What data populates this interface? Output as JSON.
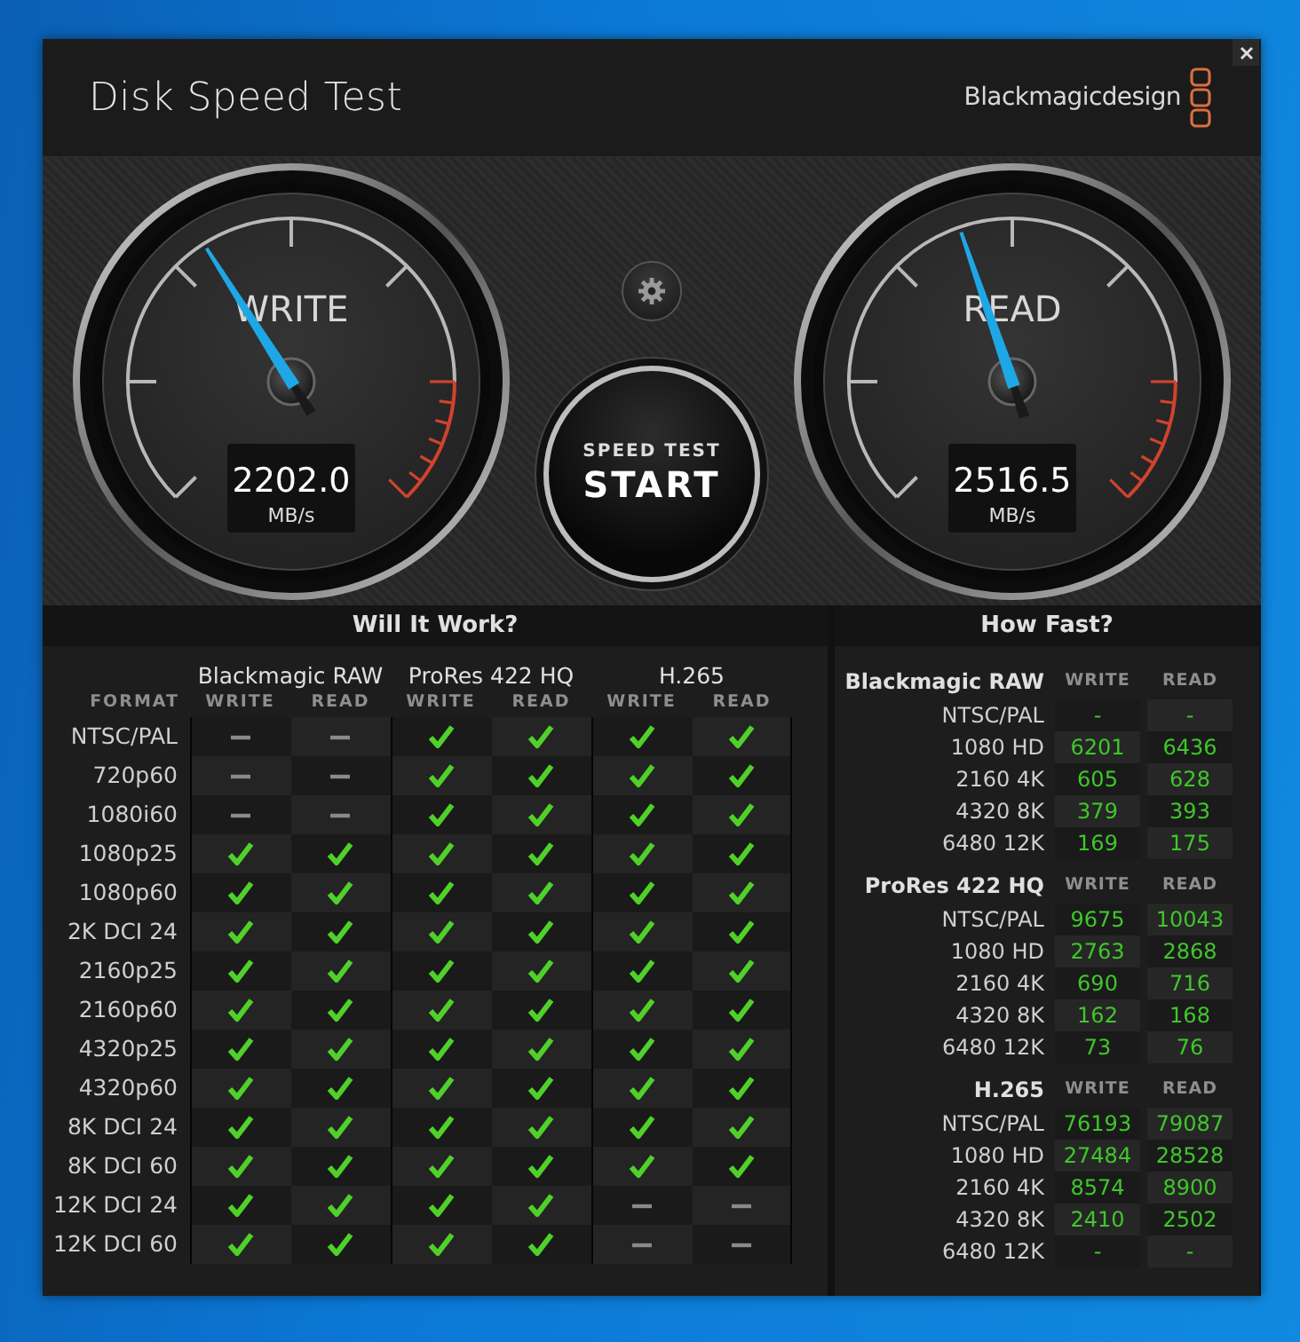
{
  "window": {
    "title": "Disk Speed Test",
    "brand": "Blackmagicdesign"
  },
  "gauges": [
    {
      "label": "WRITE",
      "value": "2202.0",
      "unit": "MB/s",
      "level": 0.38
    },
    {
      "label": "READ",
      "value": "2516.5",
      "unit": "MB/s",
      "level": 0.43
    }
  ],
  "start_button": {
    "caption": "SPEED TEST",
    "label": "START"
  },
  "will_it_work": {
    "title": "Will It Work?",
    "format_header": "FORMAT",
    "codecs": [
      {
        "name": "Blackmagic RAW",
        "columns": [
          "WRITE",
          "READ"
        ]
      },
      {
        "name": "ProRes 422 HQ",
        "columns": [
          "WRITE",
          "READ"
        ]
      },
      {
        "name": "H.265",
        "columns": [
          "WRITE",
          "READ"
        ]
      }
    ],
    "rows": [
      {
        "format": "NTSC/PAL",
        "supported": [
          false,
          false,
          true,
          true,
          true,
          true
        ]
      },
      {
        "format": "720p60",
        "supported": [
          false,
          false,
          true,
          true,
          true,
          true
        ]
      },
      {
        "format": "1080i60",
        "supported": [
          false,
          false,
          true,
          true,
          true,
          true
        ]
      },
      {
        "format": "1080p25",
        "supported": [
          true,
          true,
          true,
          true,
          true,
          true
        ]
      },
      {
        "format": "1080p60",
        "supported": [
          true,
          true,
          true,
          true,
          true,
          true
        ]
      },
      {
        "format": "2K DCI 24",
        "supported": [
          true,
          true,
          true,
          true,
          true,
          true
        ]
      },
      {
        "format": "2160p25",
        "supported": [
          true,
          true,
          true,
          true,
          true,
          true
        ]
      },
      {
        "format": "2160p60",
        "supported": [
          true,
          true,
          true,
          true,
          true,
          true
        ]
      },
      {
        "format": "4320p25",
        "supported": [
          true,
          true,
          true,
          true,
          true,
          true
        ]
      },
      {
        "format": "4320p60",
        "supported": [
          true,
          true,
          true,
          true,
          true,
          true
        ]
      },
      {
        "format": "8K DCI 24",
        "supported": [
          true,
          true,
          true,
          true,
          true,
          true
        ]
      },
      {
        "format": "8K DCI 60",
        "supported": [
          true,
          true,
          true,
          true,
          true,
          true
        ]
      },
      {
        "format": "12K DCI 24",
        "supported": [
          true,
          true,
          true,
          true,
          false,
          false
        ]
      },
      {
        "format": "12K DCI 60",
        "supported": [
          true,
          true,
          true,
          true,
          false,
          false
        ]
      }
    ]
  },
  "how_fast": {
    "title": "How Fast?",
    "groups": [
      {
        "codec": "Blackmagic RAW",
        "columns": [
          "WRITE",
          "READ"
        ],
        "rows": [
          {
            "resolution": "NTSC/PAL",
            "write": "-",
            "read": "-"
          },
          {
            "resolution": "1080 HD",
            "write": "6201",
            "read": "6436"
          },
          {
            "resolution": "2160 4K",
            "write": "605",
            "read": "628"
          },
          {
            "resolution": "4320 8K",
            "write": "379",
            "read": "393"
          },
          {
            "resolution": "6480 12K",
            "write": "169",
            "read": "175"
          }
        ]
      },
      {
        "codec": "ProRes 422 HQ",
        "columns": [
          "WRITE",
          "READ"
        ],
        "rows": [
          {
            "resolution": "NTSC/PAL",
            "write": "9675",
            "read": "10043"
          },
          {
            "resolution": "1080 HD",
            "write": "2763",
            "read": "2868"
          },
          {
            "resolution": "2160 4K",
            "write": "690",
            "read": "716"
          },
          {
            "resolution": "4320 8K",
            "write": "162",
            "read": "168"
          },
          {
            "resolution": "6480 12K",
            "write": "73",
            "read": "76"
          }
        ]
      },
      {
        "codec": "H.265",
        "columns": [
          "WRITE",
          "READ"
        ],
        "rows": [
          {
            "resolution": "NTSC/PAL",
            "write": "76193",
            "read": "79087"
          },
          {
            "resolution": "1080 HD",
            "write": "27484",
            "read": "28528"
          },
          {
            "resolution": "2160 4K",
            "write": "8574",
            "read": "8900"
          },
          {
            "resolution": "4320 8K",
            "write": "2410",
            "read": "2502"
          },
          {
            "resolution": "6480 12K",
            "write": "-",
            "read": "-"
          }
        ]
      }
    ]
  }
}
